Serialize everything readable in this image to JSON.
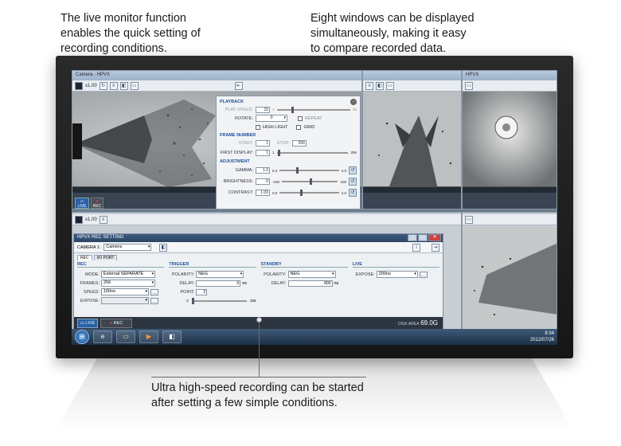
{
  "callouts": {
    "top_left": [
      "The live monitor function",
      "enables the quick setting of",
      "recording conditions."
    ],
    "top_right": [
      "Eight windows can be displayed",
      "simultaneously, making it easy",
      "to compare recorded data."
    ],
    "bottom": [
      "Ultra high-speed recording can be started",
      "after setting a few simple conditions."
    ]
  },
  "app": {
    "camera_window_title": "Camera - HPVX",
    "right_window_title": "HPVX",
    "zoom_label": "x1.00",
    "live_label": "LIVE",
    "rec_label": "REC"
  },
  "playback_panel": {
    "playback_header": "PLAYBACK",
    "play_speed_label": "PLAY SPEED:",
    "play_speed_value": "15",
    "play_speed_min": "1",
    "play_speed_max": "32",
    "rotate_label": "ROTATE:",
    "rotate_value": "0",
    "repeat_label": "REPEAT",
    "high_light_label": "HIGH LIGHT",
    "grid_label": "GRID",
    "frame_number_header": "FRAME NUMBER",
    "start_label": "START:",
    "start_value": "1",
    "stop_label": "STOP:",
    "stop_value": "256",
    "frame_min": "1",
    "frame_max": "256",
    "first_display_label": "FIRST DISPLAY:",
    "first_display_value": "1",
    "adjustment_header": "ADJUSTMENT",
    "gamma_label": "GAMMA:",
    "gamma_value": "1.0",
    "gamma_min": "0.3",
    "gamma_max": "3.0",
    "brightness_label": "BRIGHTNESS:",
    "brightness_value": "0",
    "brightness_min": "-100",
    "brightness_max": "100",
    "contrast_label": "CONTRAST:",
    "contrast_value": "1.00",
    "contrast_min": "0.5",
    "contrast_max": "2.0"
  },
  "rec_setting": {
    "title": "HPVX REC SETTING",
    "camera_label": "CAMERA 1:",
    "camera_value": "Camera",
    "tab_rec": "REC",
    "tab_io": "I/O PORT",
    "rec_header": "REC",
    "mode_label": "MODE:",
    "mode_value": "External SEPARATE",
    "frames_label": "FRAMES:",
    "frames_value": "256",
    "speed_label": "SPEED:",
    "speed_value": "100ns",
    "expose_label": "EXPOSE:",
    "trigger_header": "TRIGGER",
    "trig_polarity_label": "POLARITY:",
    "trig_polarity_value": "NEG",
    "delay_label": "DELAY:",
    "trig_delay_value": "0",
    "delay_unit": "ns",
    "point_label": "POINT:",
    "point_value": "2",
    "point_min": "2",
    "point_max": "256",
    "standby_header": "STANDBY",
    "sb_polarity_label": "POLARITY:",
    "sb_polarity_value": "NEG",
    "sb_delay_label": "DELAY:",
    "sb_delay_value": "800",
    "sb_delay_unit": "ns",
    "live_header": "LIVE",
    "live_expose_label": "EXPOSE:",
    "live_expose_value": "200ns",
    "footer_live": "LIVE",
    "footer_rec": "REC",
    "disk_area_label": "DISK AREA",
    "disk_area_value": "69.0G"
  },
  "taskbar": {
    "time": "8:34",
    "date": "2012/07/26"
  }
}
